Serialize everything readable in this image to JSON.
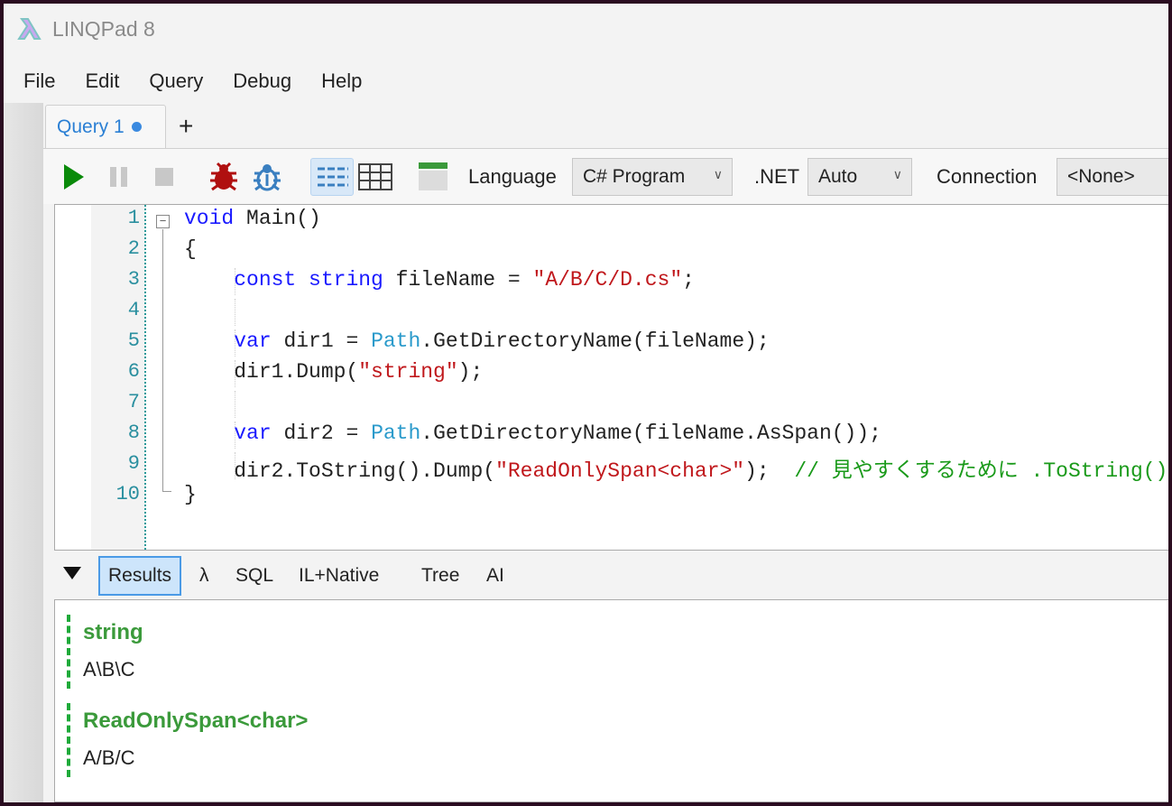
{
  "window": {
    "title": "LINQPad 8"
  },
  "menu": [
    "File",
    "Edit",
    "Query",
    "Debug",
    "Help"
  ],
  "tabs": {
    "query_tab": "Query 1",
    "add": "+"
  },
  "toolbar": {
    "language_label": "Language",
    "language_value": "C# Program",
    "net_label": ".NET",
    "net_value": "Auto",
    "connection_label": "Connection",
    "connection_value": "<None>"
  },
  "editor": {
    "lines": [
      {
        "n": "1",
        "tokens": [
          [
            "kw",
            "void"
          ],
          [
            "",
            " Main()"
          ]
        ]
      },
      {
        "n": "2",
        "tokens": [
          [
            "",
            "{"
          ]
        ]
      },
      {
        "n": "3",
        "tokens": [
          [
            "",
            "    "
          ],
          [
            "kw",
            "const"
          ],
          [
            "",
            " "
          ],
          [
            "kw",
            "string"
          ],
          [
            "",
            " fileName = "
          ],
          [
            "str",
            "\"A/B/C/D.cs\""
          ],
          [
            "",
            ";"
          ]
        ]
      },
      {
        "n": "4",
        "tokens": []
      },
      {
        "n": "5",
        "tokens": [
          [
            "",
            "    "
          ],
          [
            "kw",
            "var"
          ],
          [
            "",
            " dir1 = "
          ],
          [
            "ty",
            "Path"
          ],
          [
            "",
            ".GetDirectoryName(fileName);"
          ]
        ]
      },
      {
        "n": "6",
        "tokens": [
          [
            "",
            "    dir1.Dump("
          ],
          [
            "str",
            "\"string\""
          ],
          [
            "",
            ");"
          ]
        ]
      },
      {
        "n": "7",
        "tokens": []
      },
      {
        "n": "8",
        "tokens": [
          [
            "",
            "    "
          ],
          [
            "kw",
            "var"
          ],
          [
            "",
            " dir2 = "
          ],
          [
            "ty",
            "Path"
          ],
          [
            "",
            ".GetDirectoryName(fileName.AsSpan());"
          ]
        ]
      },
      {
        "n": "9",
        "tokens": [
          [
            "",
            "    dir2.ToString().Dump("
          ],
          [
            "str",
            "\"ReadOnlySpan<char>\""
          ],
          [
            "",
            ");  "
          ],
          [
            "cm",
            "// 見やすくするために .ToString()"
          ]
        ]
      },
      {
        "n": "10",
        "tokens": [
          [
            "",
            "}"
          ]
        ]
      }
    ]
  },
  "results_tabs": [
    "Results",
    "λ",
    "SQL",
    "IL+Native",
    "Tree",
    "AI"
  ],
  "results": [
    {
      "heading": "string",
      "value": "A\\B\\C"
    },
    {
      "heading": "ReadOnlySpan<char>",
      "value": "A/B/C"
    }
  ]
}
